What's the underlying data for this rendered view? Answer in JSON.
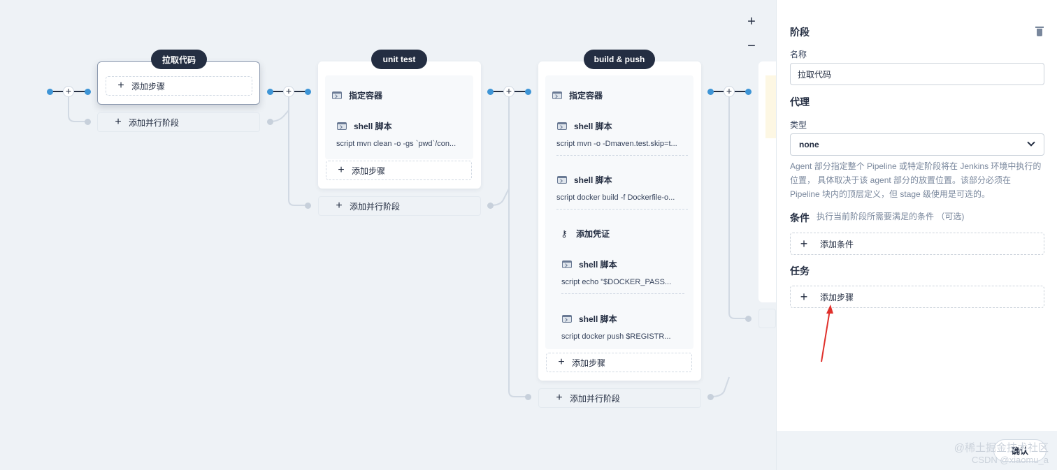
{
  "canvas": {
    "zoom_in": "+",
    "zoom_out": "−",
    "stages": [
      {
        "title": "拉取代码",
        "add_step": "添加步骤",
        "add_parallel": "添加并行阶段"
      },
      {
        "title": "unit test",
        "container": "指定容器",
        "steps": [
          {
            "name": "shell 脚本",
            "script": "script   mvn clean -o -gs `pwd`/con..."
          }
        ],
        "add_step": "添加步骤",
        "add_parallel": "添加并行阶段"
      },
      {
        "title": "build & push",
        "container": "指定容器",
        "steps": [
          {
            "name": "shell 脚本",
            "script": "script   mvn -o -Dmaven.test.skip=t..."
          },
          {
            "name": "shell 脚本",
            "script": "script   docker build -f Dockerfile-o..."
          }
        ],
        "credential": "添加凭证",
        "credential_steps": [
          {
            "name": "shell 脚本",
            "script": "script   echo \"$DOCKER_PASS..."
          },
          {
            "name": "shell 脚本",
            "script": "script   docker push $REGISTR..."
          }
        ],
        "add_step": "添加步骤",
        "add_parallel": "添加并行阶段"
      }
    ],
    "icons": {
      "shell": "terminal-icon",
      "credential": "key-icon",
      "plus": "plus-icon"
    }
  },
  "panel": {
    "stage_heading": "阶段",
    "name_label": "名称",
    "name_value": "拉取代码",
    "agent_heading": "代理",
    "type_label": "类型",
    "type_value": "none",
    "agent_desc_lines": [
      "Agent 部分指定整个 Pipeline 或特定阶段将在 Jenkins 环境中执行的",
      "位置， 具体取决于该 agent 部分的放置位置。该部分必须在",
      "Pipeline 块内的顶层定义，但 stage 级使用是可选的。"
    ],
    "conditions_heading": "条件",
    "conditions_hint": "执行当前阶段所需要满足的条件 （可选)",
    "add_condition": "添加条件",
    "tasks_heading": "任务",
    "add_step": "添加步骤",
    "confirm": "确认"
  },
  "watermark": {
    "line1": "@稀土掘金技术社区",
    "line2": "CSDN @xiaomu_a"
  },
  "colors": {
    "node_blue": "#3e95d6",
    "dark_pill": "#242e42",
    "canvas_bg": "#eef2f6",
    "annotation_red": "#e0302b"
  }
}
